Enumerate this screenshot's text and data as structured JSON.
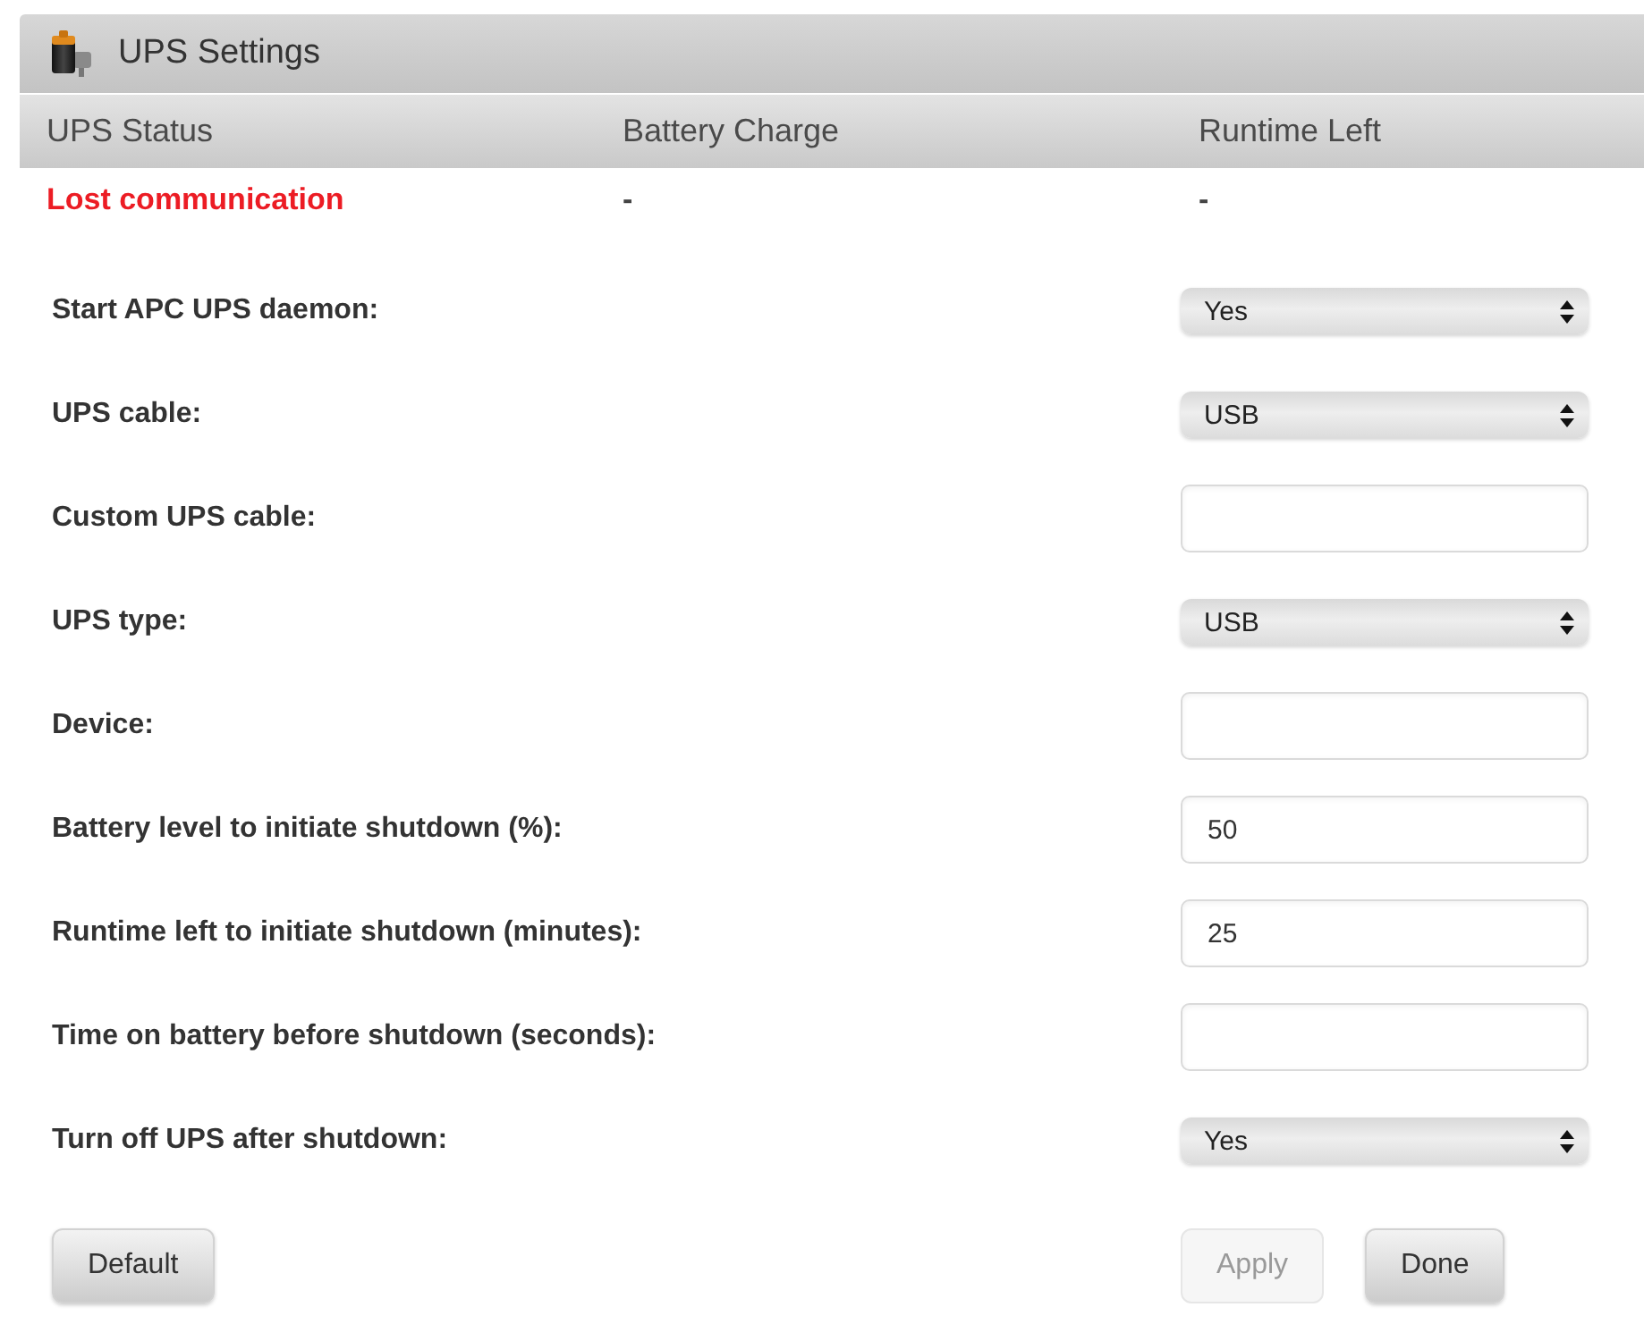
{
  "window": {
    "title": "UPS Settings"
  },
  "status": {
    "columns": [
      "UPS Status",
      "Battery Charge",
      "Runtime Left"
    ],
    "cells": [
      {
        "text": "Lost communication",
        "alert": true
      },
      {
        "text": "-",
        "alert": false
      },
      {
        "text": "-",
        "alert": false
      }
    ]
  },
  "settings": [
    {
      "label": "Start APC UPS daemon:",
      "kind": "select",
      "value": "Yes"
    },
    {
      "label": "UPS cable:",
      "kind": "select",
      "value": "USB"
    },
    {
      "label": "Custom UPS cable:",
      "kind": "input"
    },
    {
      "label": "UPS type:",
      "kind": "select",
      "value": "USB"
    },
    {
      "label": "Device:",
      "kind": "input"
    },
    {
      "label": "Battery level to initiate shutdown (%):",
      "kind": "input",
      "value": "50"
    },
    {
      "label": "Runtime left to initiate shutdown (minutes):",
      "kind": "input",
      "value": "25"
    },
    {
      "label": "Time on battery before shutdown (seconds):",
      "kind": "input"
    },
    {
      "label": "Turn off UPS after shutdown:",
      "kind": "select",
      "value": "Yes"
    }
  ],
  "buttons": {
    "left": [
      {
        "label": "Default",
        "disabled": false
      }
    ],
    "right": [
      {
        "label": "Apply",
        "disabled": true
      },
      {
        "label": "Done",
        "disabled": false
      }
    ]
  }
}
